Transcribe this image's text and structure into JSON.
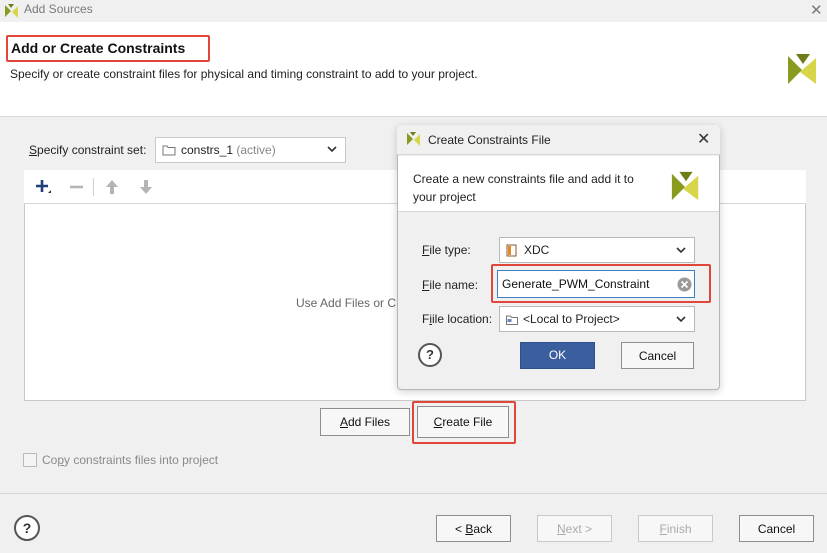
{
  "window": {
    "title": "Add Sources"
  },
  "header": {
    "title": "Add or Create Constraints",
    "subtitle": "Specify or create constraint files for physical and timing constraint to add to your project."
  },
  "constraint_set": {
    "label": "pecify constraint set:",
    "label_mnemonic": "S",
    "value": "constrs_1",
    "status": "(active)"
  },
  "panel": {
    "empty_text": "Use Add Files or C"
  },
  "buttons": {
    "add_files": "dd Files",
    "add_files_mnemonic": "A",
    "create_file": "reate File",
    "create_file_mnemonic": "C"
  },
  "copy_option": {
    "label": "y constraints files into project",
    "label_prefix": "Co",
    "label_mnemonic": "p"
  },
  "footer": {
    "help": "?",
    "back": "ack",
    "back_prefix": "< ",
    "back_mnemonic": "B",
    "next": "ext >",
    "next_mnemonic": "N",
    "finish": "inish",
    "finish_mnemonic": "F",
    "cancel": "Cancel"
  },
  "dialog": {
    "title": "Create Constraints File",
    "description": "Create a new constraints file and add it to your project",
    "file_type": {
      "label": "ile type:",
      "mnemonic": "F",
      "value": "XDC"
    },
    "file_name": {
      "label": "ile name:",
      "mnemonic": "F",
      "value": "Generate_PWM_Constraint"
    },
    "file_location": {
      "label": "ile location:",
      "prefix": "F",
      "mnemonic": "i",
      "value": "<Local to Project>"
    },
    "help": "?",
    "ok": "OK",
    "cancel": "Cancel"
  },
  "colors": {
    "highlight": "#e0463a",
    "ok_button": "#3b5e9e",
    "logo_olive": "#8a9a1e",
    "logo_yellow": "#d7d64a"
  }
}
